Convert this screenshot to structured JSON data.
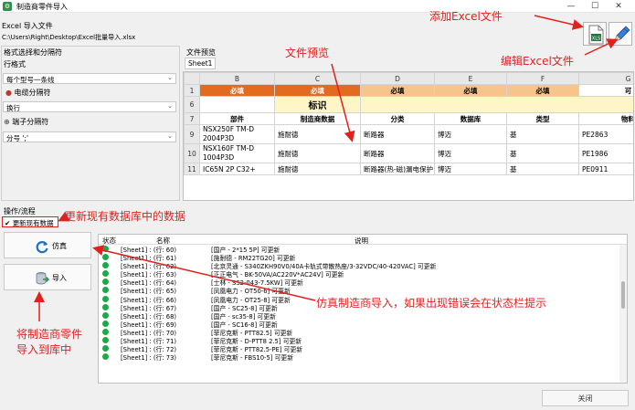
{
  "window": {
    "title": "制造商零件导入",
    "minimize": "—",
    "maximize": "☐",
    "close": "✕"
  },
  "file": {
    "label": "Excel 导入文件",
    "path": "C:\\Users\\Right\\Desktop\\Excel批量导入.xlsx"
  },
  "format": {
    "group_label": "格式选择和分隔符",
    "row_format_label": "行格式",
    "row_format_value": "每个型号一条线",
    "wire_sep_label": "电缆分隔符",
    "wire_sep_value": "换行",
    "terminal_sep_label": "端子分隔符",
    "terminal_sep_value": "分号 ';'"
  },
  "preview": {
    "label": "文件预览",
    "sheet_tab": "Sheet1",
    "columns": [
      "B",
      "C",
      "D",
      "E",
      "F",
      "G"
    ],
    "row1": {
      "num": "1",
      "cells": [
        "必填",
        "必填",
        "必填",
        "必填",
        "必填",
        "可"
      ]
    },
    "row6": {
      "num": "6",
      "text": "标识"
    },
    "row7": {
      "num": "7",
      "cells": [
        "部件",
        "制造商数据",
        "分类",
        "数据库",
        "类型",
        "物料"
      ]
    },
    "data": [
      {
        "num": "9",
        "cells": [
          "NSX250F TM-D 2004P3D",
          "施耐德",
          "断路器",
          "博迈",
          "基",
          "PE2863"
        ]
      },
      {
        "num": "10",
        "cells": [
          "NSX160F TM-D 1004P3D",
          "施耐德",
          "断路器",
          "博迈",
          "基",
          "PE1986"
        ]
      },
      {
        "num": "11",
        "cells": [
          "IC65N 2P C32+",
          "施耐德",
          "断路器(热-磁)漏电保护",
          "博迈",
          "基",
          "PE0911"
        ]
      }
    ]
  },
  "operations": {
    "label": "操作/流程",
    "update_checkbox": "更新现有数据",
    "simulate_button": "仿真",
    "import_button": "导入"
  },
  "log": {
    "headers": {
      "status": "状态",
      "name": "名称",
      "desc": "说明"
    },
    "rows": [
      {
        "name": "[Sheet1] : (行: 60)",
        "desc": "[国产 - 2*15 5P] 可更新"
      },
      {
        "name": "[Sheet1] : (行: 61)",
        "desc": "[施耐德 - RM22TG20] 可更新"
      },
      {
        "name": "[Sheet1] : (行: 62)",
        "desc": "[北京灵通 - S340ZKH90V0/40A卡轨式带散热座/3-32VDC/40-420VAC] 可更新"
      },
      {
        "name": "[Sheet1] : (行: 63)",
        "desc": "[正正电气 - BK-50VA/AC220V*AC24V] 可更新"
      },
      {
        "name": "[Sheet1] : (行: 64)",
        "desc": "[士林 - SS2-043-7.5KW] 可更新"
      },
      {
        "name": "[Sheet1] : (行: 65)",
        "desc": "[凤凰电力 - OT50-6] 可更新"
      },
      {
        "name": "[Sheet1] : (行: 66)",
        "desc": "[凤凰电力 - OT25-8] 可更新"
      },
      {
        "name": "[Sheet1] : (行: 67)",
        "desc": "[国产 - SC25-8] 可更新"
      },
      {
        "name": "[Sheet1] : (行: 68)",
        "desc": "[国产 - sc35-8] 可更新"
      },
      {
        "name": "[Sheet1] : (行: 69)",
        "desc": "[国产 - SC16-8] 可更新"
      },
      {
        "name": "[Sheet1] : (行: 70)",
        "desc": "[菲尼克斯 - PTT82.5] 可更新"
      },
      {
        "name": "[Sheet1] : (行: 71)",
        "desc": "[菲尼克斯 - D-PTT8 2.5] 可更新"
      },
      {
        "name": "[Sheet1] : (行: 72)",
        "desc": "[菲尼克斯 - PTT82.5-PE] 可更新"
      },
      {
        "name": "[Sheet1] : (行: 73)",
        "desc": "[菲尼克斯 - FBS10-5] 可更新"
      }
    ]
  },
  "close_button": "关闭",
  "annotations": {
    "add_excel": "添加Excel文件",
    "edit_excel": "编辑Excel文件",
    "file_preview": "文件预览",
    "update_data": "更新现有数据库中的数据",
    "simulate_note": "仿真制造商导入，如果出现错误会在状态栏提示",
    "import_note_1": "将制造商零件",
    "import_note_2": "导入到库中"
  },
  "colors": {
    "required_dark": "#e26b1f",
    "required_light": "#f7c58b",
    "annotation": "#e0221f",
    "ok": "#1fa84a"
  }
}
